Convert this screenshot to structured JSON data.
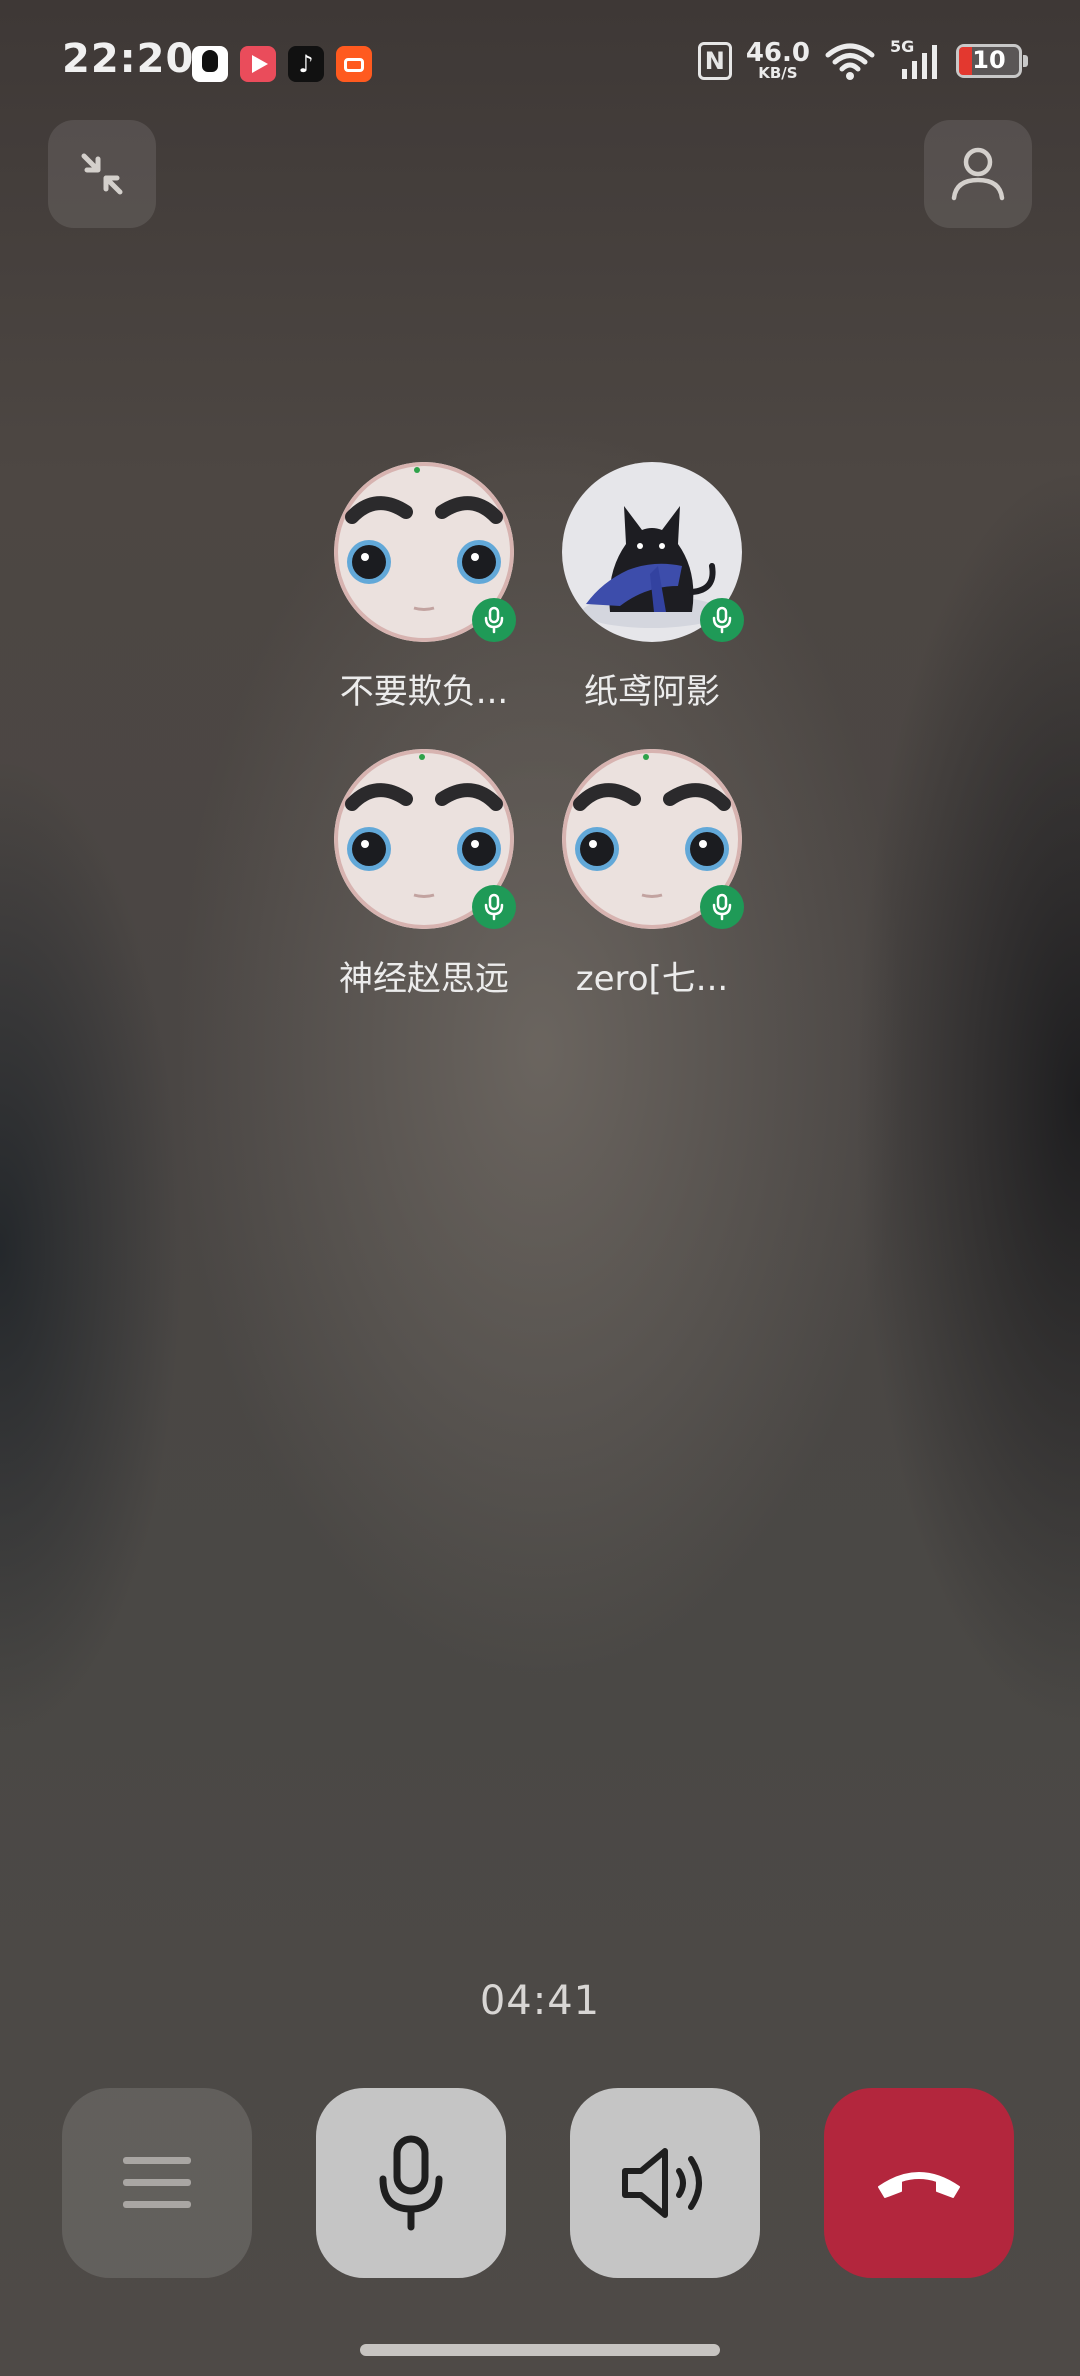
{
  "status_bar": {
    "time": "22:20",
    "apps": [
      "qq-icon",
      "video-app-icon",
      "tiktok-icon",
      "kuaishou-icon"
    ],
    "nfc_label": "N",
    "net_speed_value": "46.0",
    "net_speed_unit": "KB/S",
    "signal_label": "5G",
    "battery_level": "10"
  },
  "participants": [
    {
      "name": "不要欺负..."
    },
    {
      "name": "纸鸢阿影"
    },
    {
      "name": "神经赵思远"
    },
    {
      "name": "zero[七..."
    }
  ],
  "call": {
    "duration": "04:41"
  },
  "colors": {
    "mic_badge": "#1f9a57",
    "hangup": "#b3263d",
    "control_light": "#c5c5c5"
  }
}
